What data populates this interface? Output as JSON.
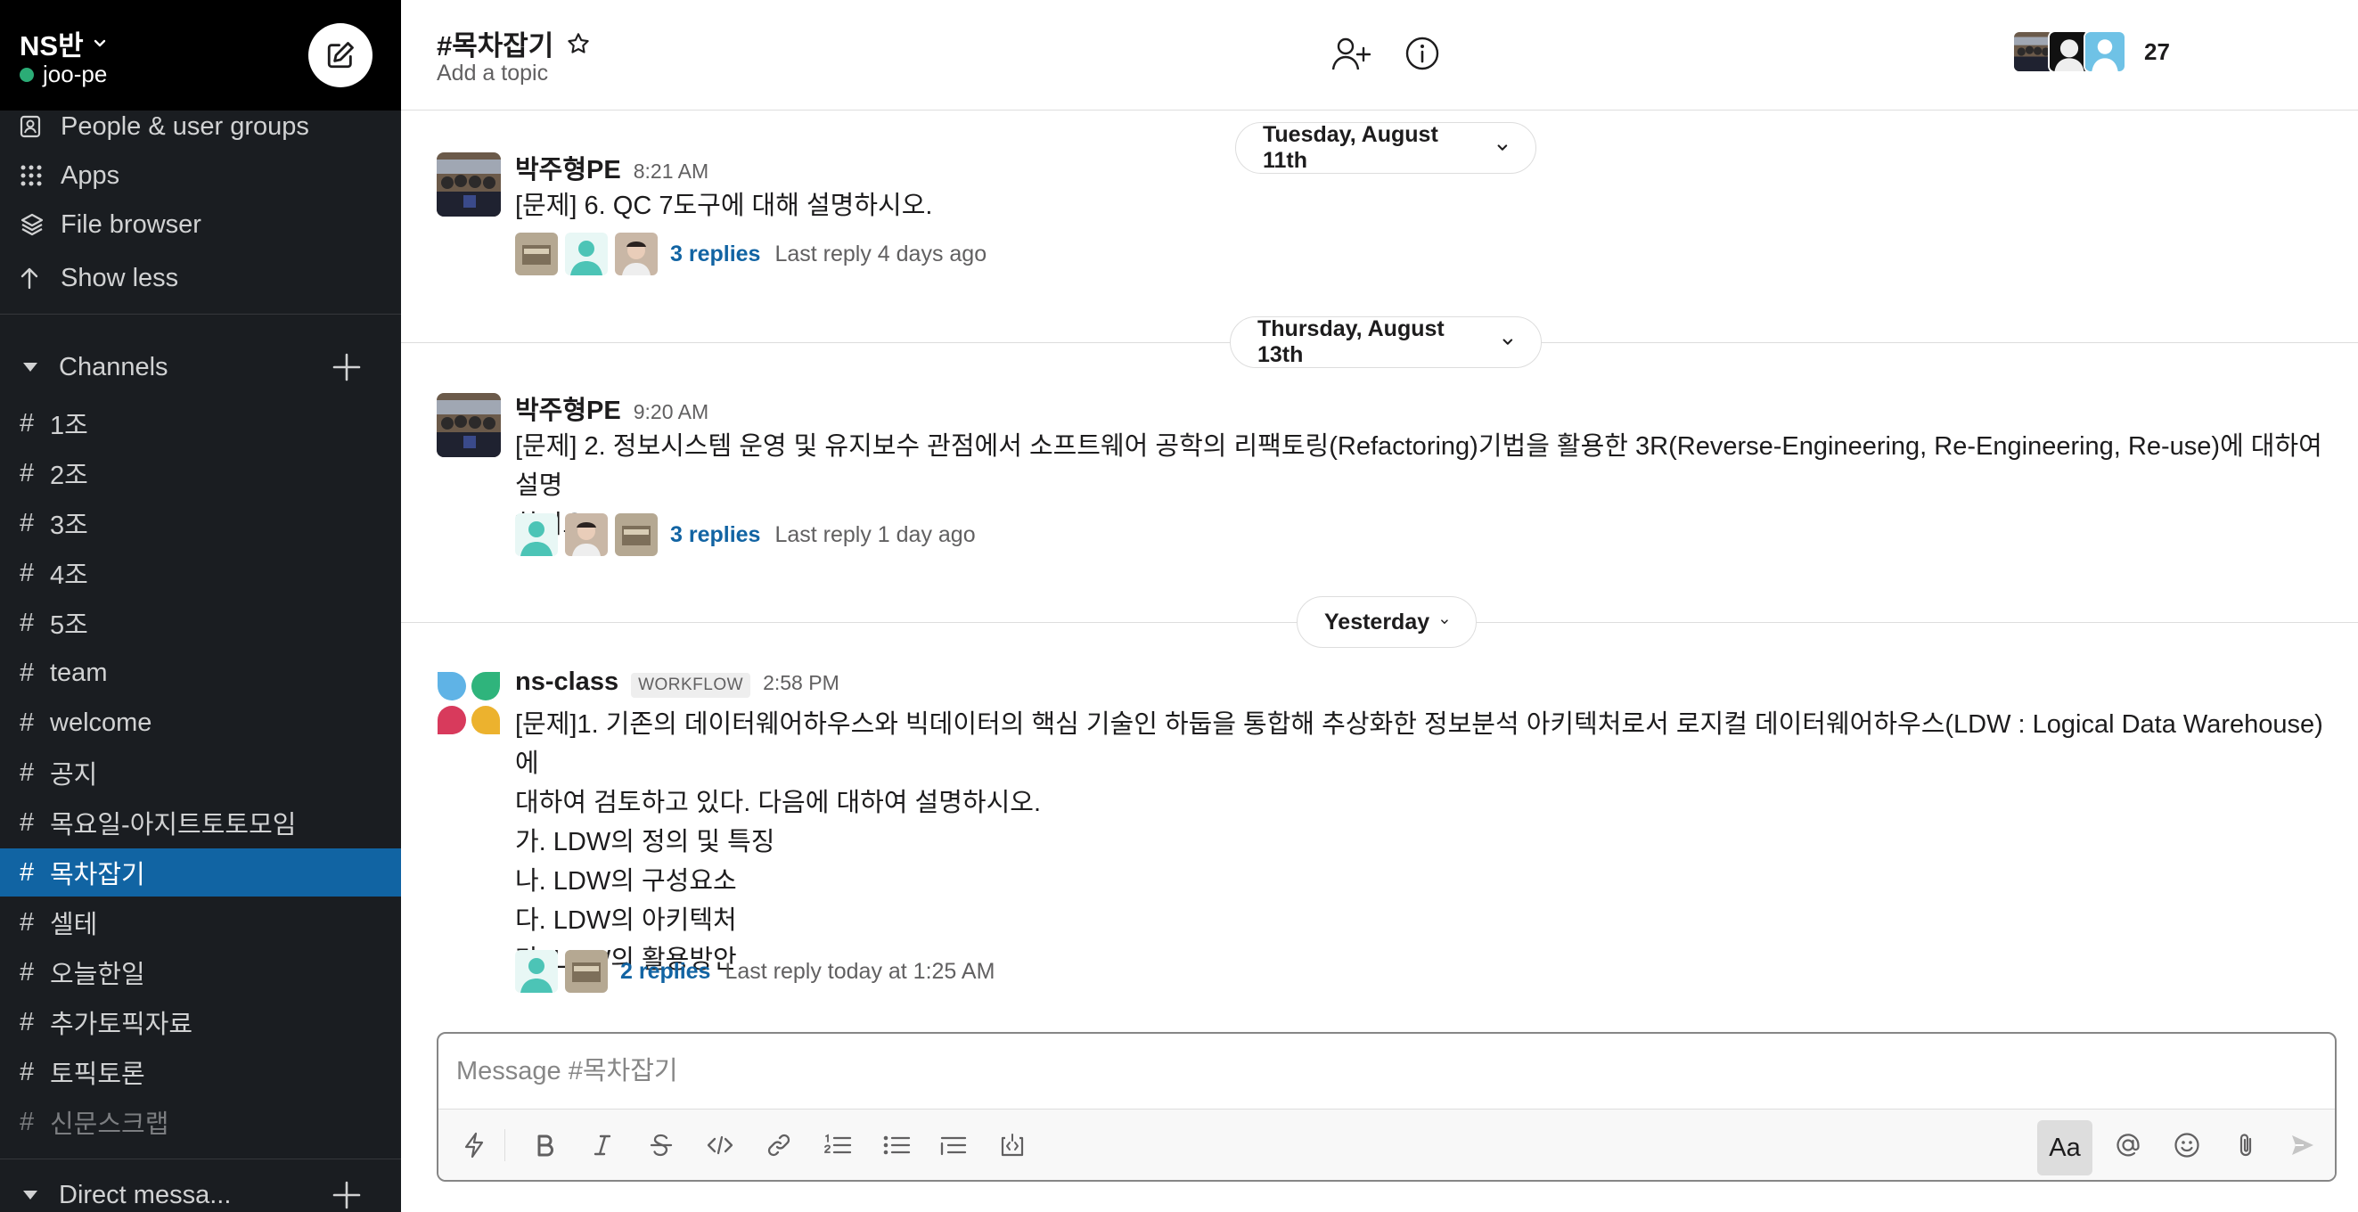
{
  "workspace": {
    "name": "NS반",
    "user": "joo-pe",
    "status_color": "#2bac76"
  },
  "sidebar": {
    "nav_items": [
      {
        "label": "People & user groups",
        "icon": "people-icon"
      },
      {
        "label": "Apps",
        "icon": "apps-grid-icon"
      },
      {
        "label": "File browser",
        "icon": "layers-icon"
      },
      {
        "label": "Show less",
        "icon": "arrow-up-icon"
      }
    ],
    "channels_section": "Channels",
    "channels": [
      "1조",
      "2조",
      "3조",
      "4조",
      "5조",
      "team",
      "welcome",
      "공지",
      "목요일-아지트토토모임",
      "목차잡기",
      "셀테",
      "오늘한일",
      "추가토픽자료",
      "토픽토론",
      "신문스크랩"
    ],
    "active_channel": "목차잡기",
    "dm_section": "Direct messa...",
    "active_color": "#1164a3"
  },
  "header": {
    "title": "#목차잡기",
    "topic": "Add a topic",
    "member_count": "27"
  },
  "dividers": {
    "d1": "Tuesday, August 11th",
    "d2": "Thursday, August 13th",
    "d3": "Yesterday"
  },
  "messages": [
    {
      "author": "박주형PE",
      "time": "8:21 AM",
      "text": "[문제] 6. QC 7도구에 대해 설명하시오.",
      "replies": "3 replies",
      "last_reply": "Last reply 4 days ago"
    },
    {
      "author": "박주형PE",
      "time": "9:20 AM",
      "line1": "[문제] 2. 정보시스템 운영 및 유지보수 관점에서 소프트웨어 공학의 리팩토링(Refactoring)기법을 활용한 3R(Reverse-Engineering, Re-Engineering, Re-use)에 대하여 설명",
      "line2": "하시오.",
      "replies": "3 replies",
      "last_reply": "Last reply 1 day ago"
    },
    {
      "author": "ns-class",
      "badge": "WORKFLOW",
      "time": "2:58 PM",
      "line1": "[문제]1. 기존의 데이터웨어하우스와 빅데이터의 핵심 기술인 하둡을 통합해 추상화한 정보분석 아키텍처로서 로지컬 데이터웨어하우스(LDW : Logical Data Warehouse)에",
      "line2": "대하여 검토하고 있다. 다음에 대하여 설명하시오.",
      "line3": "가. LDW의 정의 및 특징",
      "line4": "나. LDW의 구성요소",
      "line5": "다. LDW의 아키텍처",
      "line6": "라. LDW의 활용방안",
      "replies": "2 replies",
      "last_reply": "Last reply today at 1:25 AM"
    }
  ],
  "composer": {
    "placeholder": "Message #목차잡기",
    "format_label": "Aa"
  },
  "colors": {
    "link": "#1264a3",
    "sidebar_bg": "#1a1d21",
    "header_bg": "#000000"
  }
}
